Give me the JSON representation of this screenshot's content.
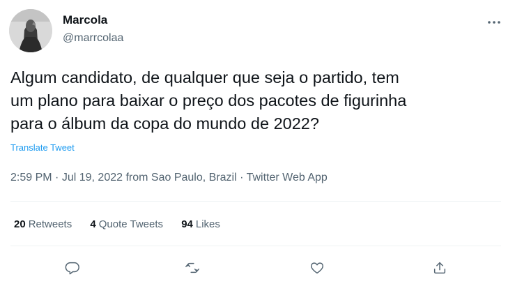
{
  "user": {
    "display_name": "Marcola",
    "handle": "@marrcolaa"
  },
  "tweet": {
    "text_lines": [
      "Algum candidato, de qualquer que seja o partido, tem",
      "um plano para baixar o preço dos pacotes de figurinha",
      "para o álbum da copa do mundo de 2022?"
    ],
    "translate_label": "Translate Tweet",
    "time": "2:59 PM",
    "date": "Jul 19, 2022",
    "location_text": "from Sao Paulo, Brazil",
    "source": "Twitter Web App",
    "separator": "·"
  },
  "stats": {
    "retweets": {
      "count": "20",
      "label": "Retweets"
    },
    "quotes": {
      "count": "4",
      "label": "Quote Tweets"
    },
    "likes": {
      "count": "94",
      "label": "Likes"
    }
  },
  "actions": [
    "reply-icon",
    "retweet-icon",
    "like-icon",
    "share-icon"
  ],
  "colors": {
    "text_primary": "#0f1419",
    "text_secondary": "#536471",
    "link": "#1d9bf0",
    "divider": "#eff3f4"
  }
}
